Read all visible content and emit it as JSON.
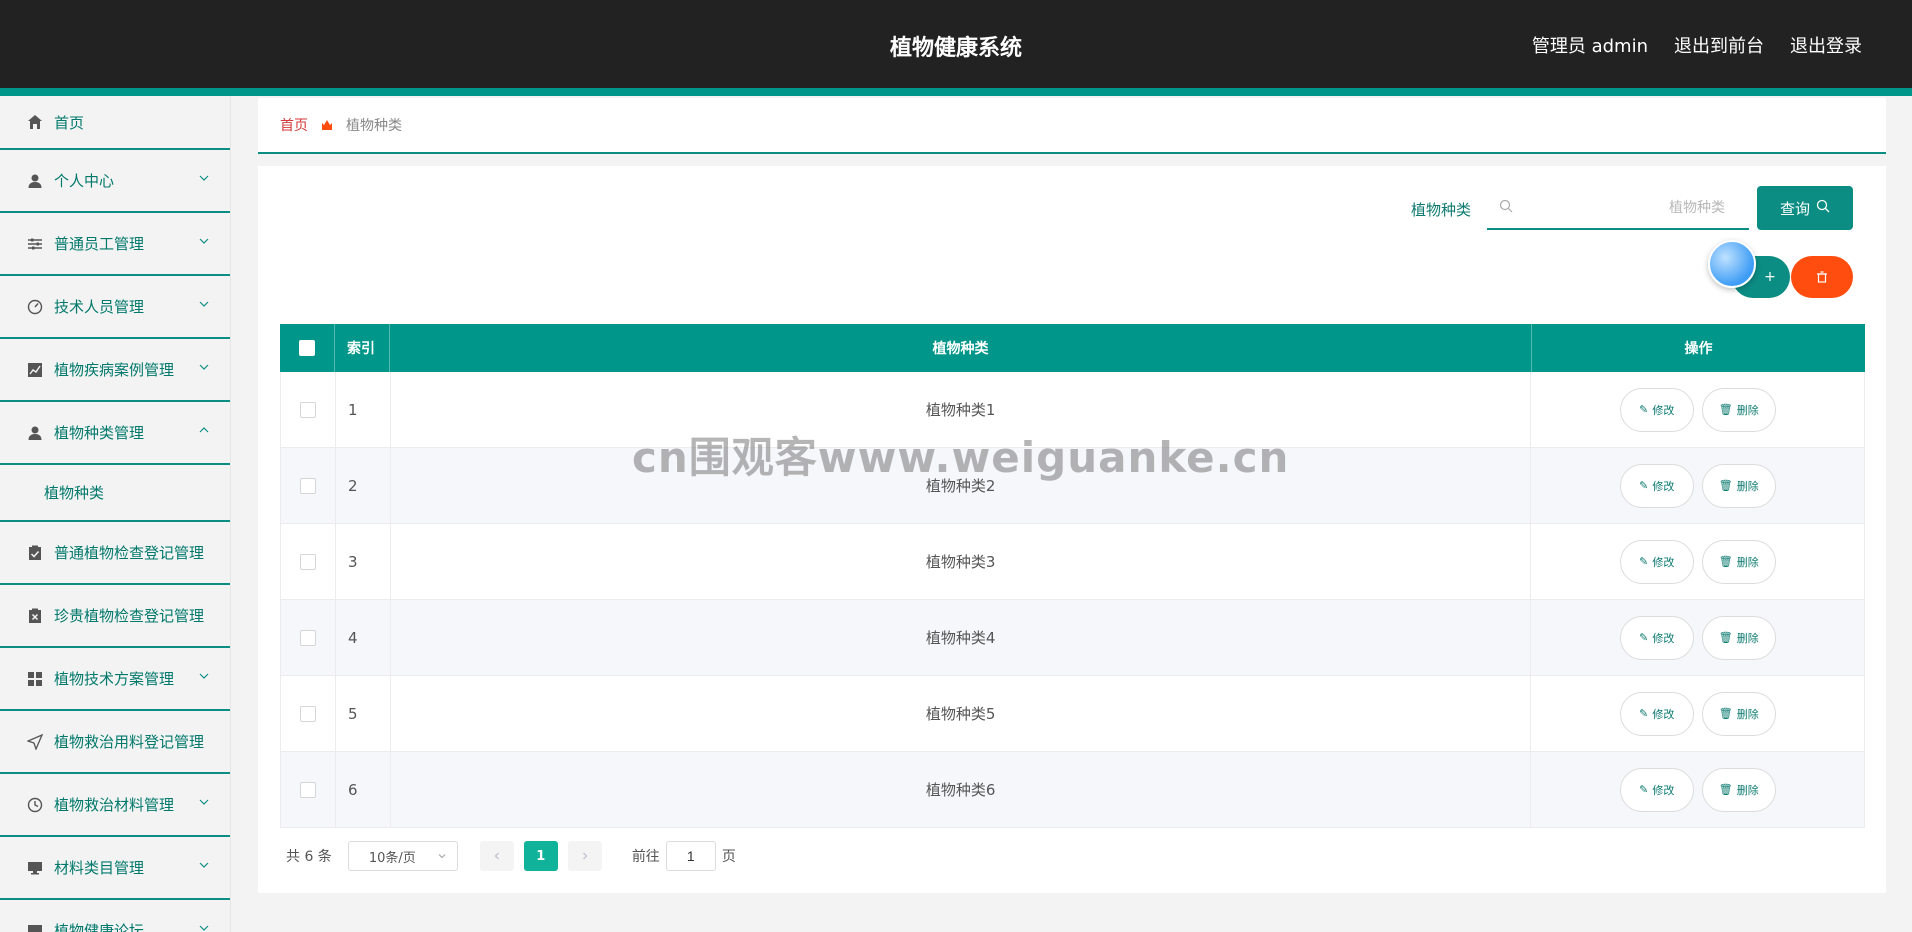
{
  "header": {
    "title": "植物健康系统",
    "admin": "管理员 admin",
    "front": "退出到前台",
    "logout": "退出登录"
  },
  "sidebar": {
    "items": [
      {
        "label": "首页",
        "icon": "home-icon"
      },
      {
        "label": "个人中心",
        "icon": "user-icon"
      },
      {
        "label": "普通员工管理",
        "icon": "sliders-icon"
      },
      {
        "label": "技术人员管理",
        "icon": "gauge-icon"
      },
      {
        "label": "植物疾病案例管理",
        "icon": "chart-icon"
      },
      {
        "label": "植物种类管理",
        "icon": "user-icon"
      },
      {
        "label": "普通植物检查登记管理",
        "icon": "clipboard-check-icon"
      },
      {
        "label": "珍贵植物检查登记管理",
        "icon": "clipboard-x-icon"
      },
      {
        "label": "植物技术方案管理",
        "icon": "grid-icon"
      },
      {
        "label": "植物救治用料登记管理",
        "icon": "send-icon"
      },
      {
        "label": "植物救治材料管理",
        "icon": "clock-icon"
      },
      {
        "label": "材料类目管理",
        "icon": "monitor-icon"
      },
      {
        "label": "植物健康论坛",
        "icon": "chat-icon"
      }
    ],
    "submenu_label": "植物种类"
  },
  "breadcrumb": {
    "home": "首页",
    "current": "植物种类"
  },
  "search": {
    "label": "植物种类",
    "placeholder": "植物种类",
    "button": "查询"
  },
  "table": {
    "headers": {
      "index": "索引",
      "name": "植物种类",
      "ops": "操作"
    },
    "rows": [
      {
        "index": "1",
        "name": "植物种类1"
      },
      {
        "index": "2",
        "name": "植物种类2"
      },
      {
        "index": "3",
        "name": "植物种类3"
      },
      {
        "index": "4",
        "name": "植物种类4"
      },
      {
        "index": "5",
        "name": "植物种类5"
      },
      {
        "index": "6",
        "name": "植物种类6"
      }
    ],
    "edit_label": "修改",
    "delete_label": "删除"
  },
  "pagination": {
    "total": "共 6 条",
    "page_size": "10条/页",
    "current_page": "1",
    "goto_prefix": "前往",
    "goto_value": "1",
    "goto_suffix": "页"
  },
  "watermark": "cn围观客www.weiguanke.cn",
  "colors": {
    "header_bg": "#222222",
    "accent": "#00968a",
    "danger": "#ff4d0f",
    "page_active": "#10b39a"
  }
}
